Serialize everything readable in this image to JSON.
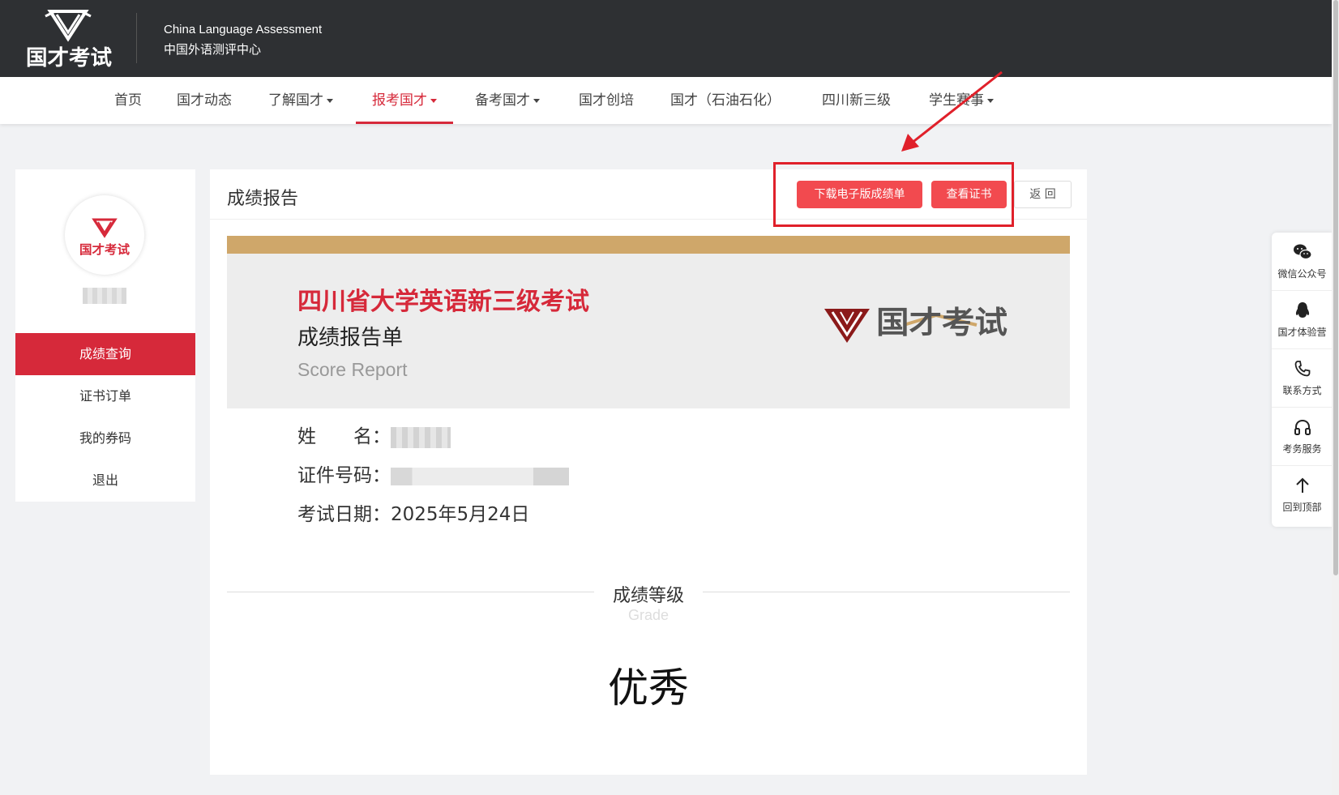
{
  "header": {
    "logo_text": "国才考试",
    "brand_en": "China Language Assessment",
    "brand_cn": "中国外语测评中心"
  },
  "nav": {
    "items": [
      {
        "label": "首页"
      },
      {
        "label": "国才动态"
      },
      {
        "label": "了解国才"
      },
      {
        "label": "报考国才"
      },
      {
        "label": "备考国才"
      },
      {
        "label": "国才创培"
      },
      {
        "label": "国才（石油石化）"
      },
      {
        "label": "四川新三级"
      },
      {
        "label": "学生赛事"
      }
    ],
    "active": "报考国才"
  },
  "sidebar": {
    "items": [
      {
        "label": "成绩查询"
      },
      {
        "label": "证书订单"
      },
      {
        "label": "我的券码"
      },
      {
        "label": "退出"
      }
    ]
  },
  "main": {
    "title": "成绩报告",
    "buttons": {
      "download": "下载电子版成绩单",
      "certificate": "查看证书",
      "back": "返 回"
    },
    "banner": {
      "title": "四川省大学英语新三级考试",
      "subtitle": "成绩报告单",
      "subtitle_en": "Score Report",
      "logo_text": "国才考试"
    },
    "info": {
      "name_label": "姓　　名：",
      "id_label": "证件号码：",
      "date_label": "考试日期：",
      "date_value": "2025年5月24日"
    },
    "grade": {
      "title": "成绩等级",
      "title_en": "Grade",
      "value": "优秀"
    }
  },
  "floatbar": {
    "items": [
      {
        "label": "微信公众号",
        "icon": "wechat-icon"
      },
      {
        "label": "国才体验营",
        "icon": "qq-penguin-icon"
      },
      {
        "label": "联系方式",
        "icon": "phone-icon"
      },
      {
        "label": "考务服务",
        "icon": "headphones-icon"
      },
      {
        "label": "回到顶部",
        "icon": "arrow-up-icon"
      }
    ]
  },
  "colors": {
    "brand_red": "#d6293a",
    "button_red": "#f24a4f",
    "header_dark": "#2e3033",
    "gold": "#cfa76a"
  }
}
